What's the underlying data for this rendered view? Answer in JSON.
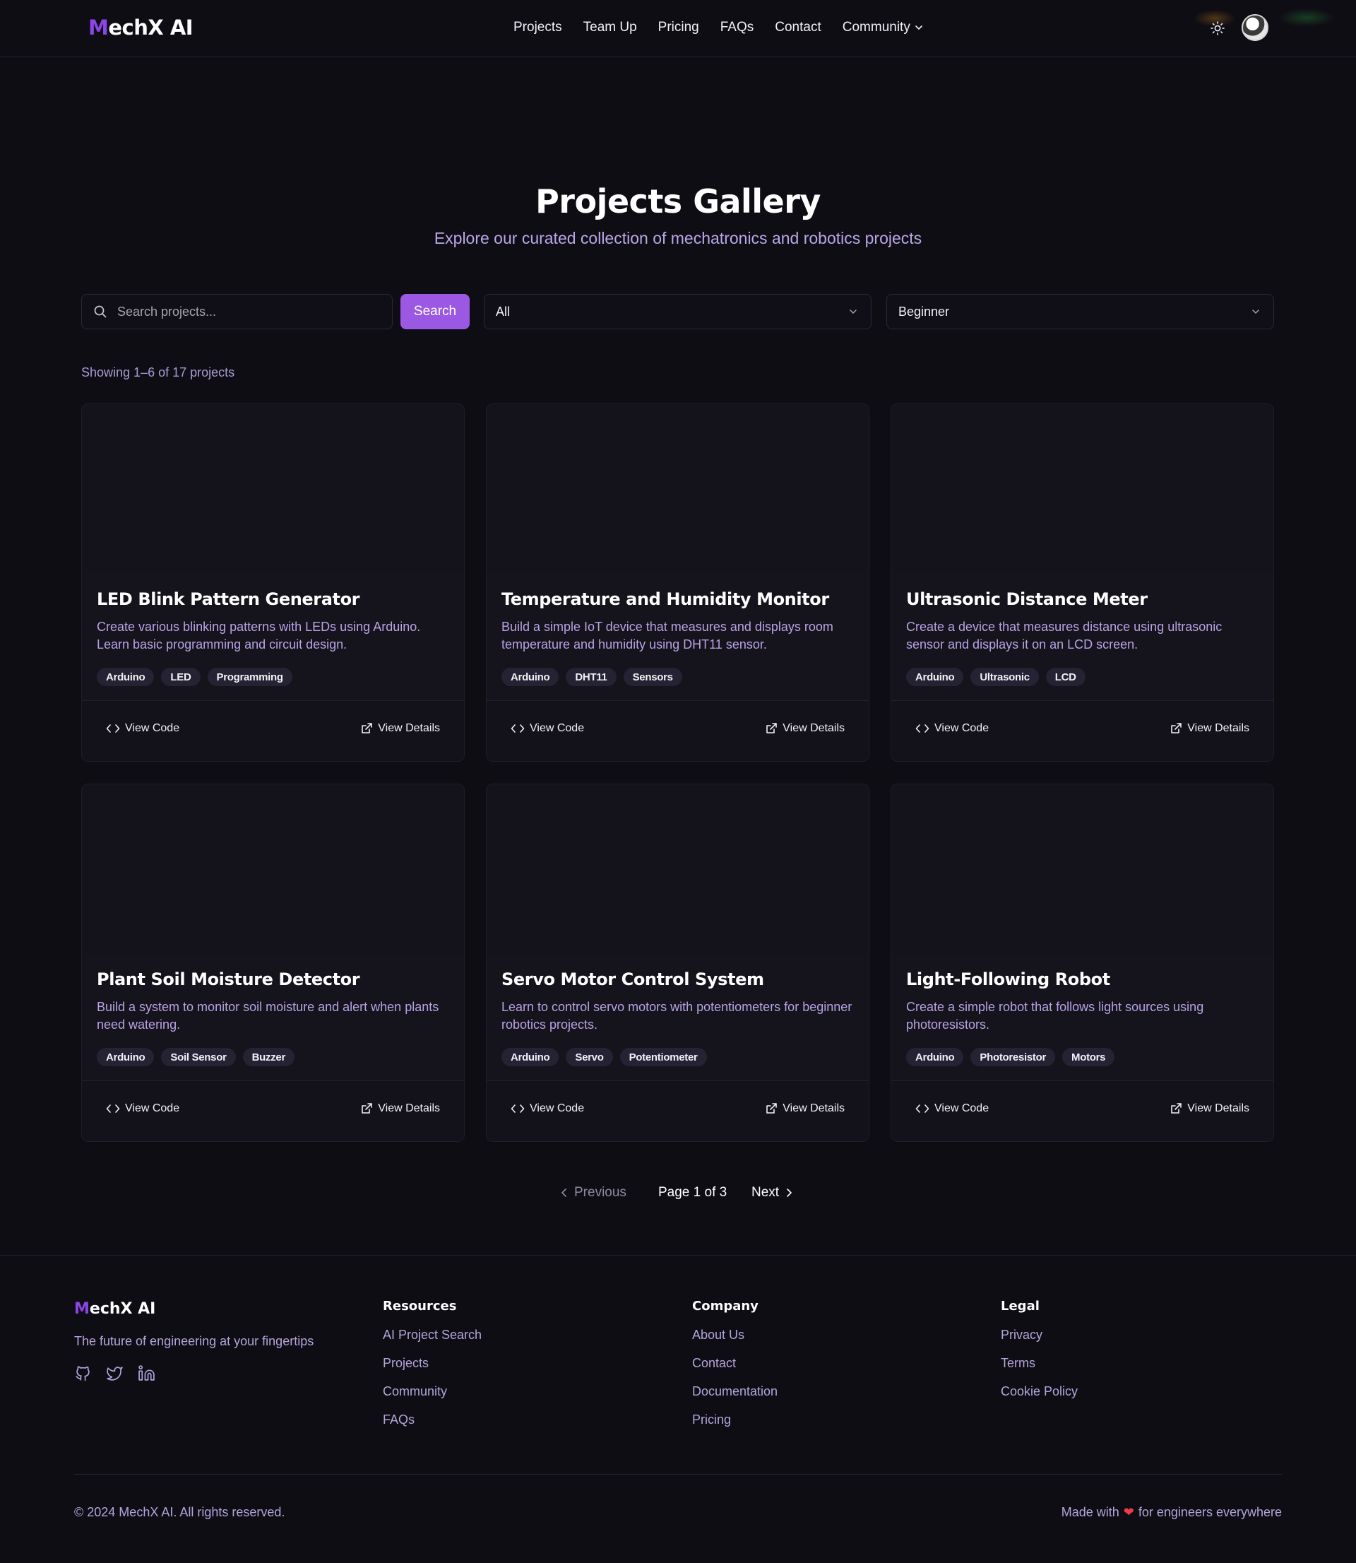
{
  "brand": {
    "logo_m": "M",
    "logo_rest": "echX AI"
  },
  "nav": {
    "links": [
      "Projects",
      "Team Up",
      "Pricing",
      "FAQs",
      "Contact"
    ],
    "community": "Community"
  },
  "hero": {
    "title": "Projects Gallery",
    "subtitle": "Explore our curated collection of mechatronics and robotics projects"
  },
  "filters": {
    "search_placeholder": "Search projects...",
    "search_button": "Search",
    "category_value": "All",
    "level_value": "Beginner"
  },
  "results": {
    "count_text": "Showing 1–6 of 17 projects"
  },
  "cards": [
    {
      "title": "LED Blink Pattern Generator",
      "description": "Create various blinking patterns with LEDs using Arduino. Learn basic programming and circuit design.",
      "tags": [
        "Arduino",
        "LED",
        "Programming"
      ],
      "view_code": "View Code",
      "view_details": "View Details"
    },
    {
      "title": "Temperature and Humidity Monitor",
      "description": "Build a simple IoT device that measures and displays room temperature and humidity using DHT11 sensor.",
      "tags": [
        "Arduino",
        "DHT11",
        "Sensors"
      ],
      "view_code": "View Code",
      "view_details": "View Details"
    },
    {
      "title": "Ultrasonic Distance Meter",
      "description": "Create a device that measures distance using ultrasonic sensor and displays it on an LCD screen.",
      "tags": [
        "Arduino",
        "Ultrasonic",
        "LCD"
      ],
      "view_code": "View Code",
      "view_details": "View Details"
    },
    {
      "title": "Plant Soil Moisture Detector",
      "description": "Build a system to monitor soil moisture and alert when plants need watering.",
      "tags": [
        "Arduino",
        "Soil Sensor",
        "Buzzer"
      ],
      "view_code": "View Code",
      "view_details": "View Details"
    },
    {
      "title": "Servo Motor Control System",
      "description": "Learn to control servo motors with potentiometers for beginner robotics projects.",
      "tags": [
        "Arduino",
        "Servo",
        "Potentiometer"
      ],
      "view_code": "View Code",
      "view_details": "View Details"
    },
    {
      "title": "Light-Following Robot",
      "description": "Create a simple robot that follows light sources using photoresistors.",
      "tags": [
        "Arduino",
        "Photoresistor",
        "Motors"
      ],
      "view_code": "View Code",
      "view_details": "View Details"
    }
  ],
  "pagination": {
    "previous": "Previous",
    "page_text": "Page 1 of 3",
    "next": "Next"
  },
  "footer": {
    "logo_m": "M",
    "logo_rest": "echX AI",
    "tagline": "The future of engineering at your fingertips",
    "social_icons": [
      "github-icon",
      "twitter-icon",
      "linkedin-icon"
    ],
    "columns": [
      {
        "heading": "Resources",
        "links": [
          "AI Project Search",
          "Projects",
          "Community",
          "FAQs"
        ]
      },
      {
        "heading": "Company",
        "links": [
          "About Us",
          "Contact",
          "Documentation",
          "Pricing"
        ]
      },
      {
        "heading": "Legal",
        "links": [
          "Privacy",
          "Terms",
          "Cookie Policy"
        ]
      }
    ],
    "copyright": "© 2024 MechX AI. All rights reserved.",
    "made_with_prefix": "Made with",
    "made_with_suffix": "for engineers everywhere"
  },
  "colors": {
    "background": "#0f0d14",
    "accent": "#9b58e3",
    "logo_accent": "#8b45e8",
    "muted_text": "#b7a4e6",
    "heart": "#ef3b4a"
  }
}
